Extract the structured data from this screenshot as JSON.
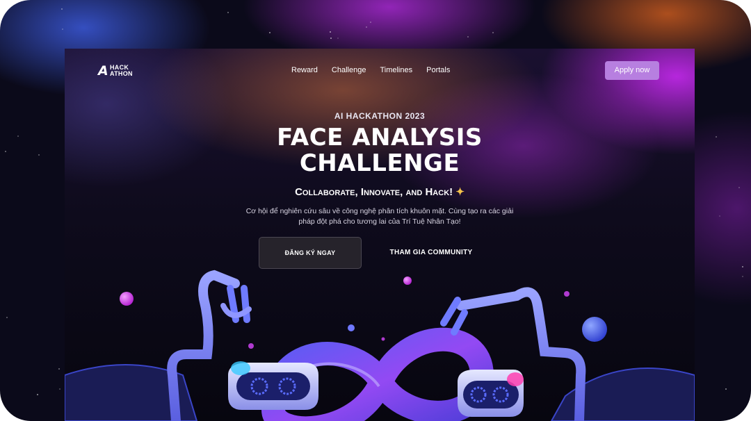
{
  "brand": {
    "mark": "A",
    "line1": "HACK",
    "line2": "ATHON"
  },
  "nav": {
    "items": [
      "Reward",
      "Challenge",
      "Timelines",
      "Portals"
    ],
    "cta": "Apply now"
  },
  "hero": {
    "eyebrow": "AI HACKATHON 2023",
    "title_line1": "FACE ANALYSIS",
    "title_line2": "CHALLENGE",
    "tagline": "Collaborate, Innovate, and Hack!",
    "tagline_icon": "✦",
    "description": "Cơ hội để nghiên cứu sâu về công nghệ phân tích khuôn mặt. Cùng tạo ra các giải pháp đột phá cho tương lai của Trí Tuệ Nhân Tạo!",
    "primary_button": "ĐĂNG KÝ NGAY",
    "secondary_button": "THAM GIA COMMUNITY"
  },
  "colors": {
    "accent": "#b77fe0",
    "sparkle": "#f3c24b",
    "background": "#0b0a1a"
  },
  "icons": {
    "sparkle": "sparkle-icon",
    "hero_art": "robot-arms-infinity-illustration"
  }
}
